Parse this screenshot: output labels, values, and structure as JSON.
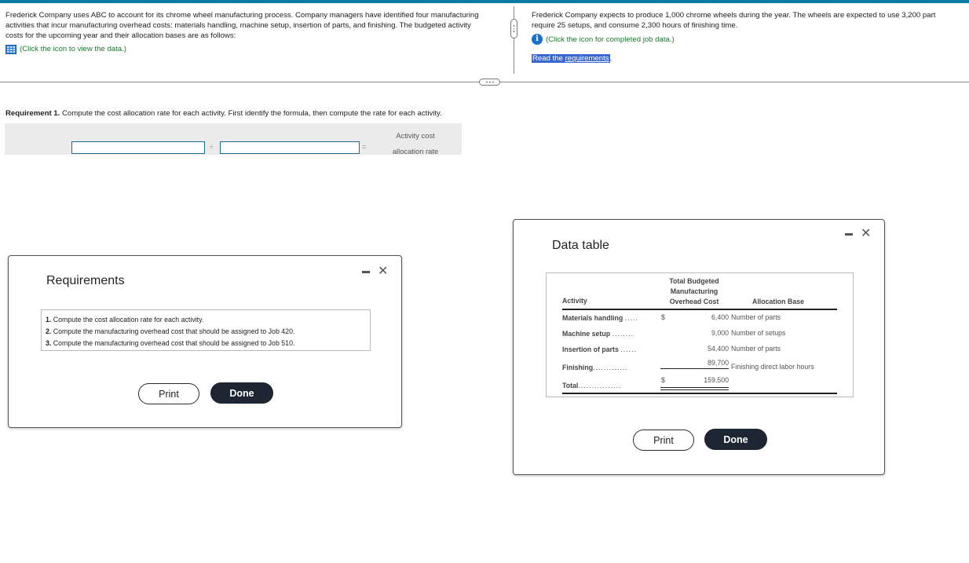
{
  "intro_left": {
    "text": "Frederick Company uses ABC to account for its chrome wheel manufacturing process. Company managers have identified four manufacturing activities that incur manufacturing overhead costs: materials handling, machine setup, insertion of parts, and finishing. The budgeted activity costs for the upcoming year and their allocation bases are as follows:",
    "data_link": "(Click the icon to view the data.)",
    "icon": "grid-icon"
  },
  "intro_right": {
    "line1": "Frederick Company expects to produce 1,000 chrome wheels during the year. The wheels are expected to use 3,200 part",
    "line2": "require 25 setups, and consume 2,300 hours of finishing time.",
    "job_link": "(Click the icon for completed job data.)",
    "icon": "info-icon",
    "read_prefix": "Read the ",
    "read_link": "requirements",
    "read_suffix": "."
  },
  "requirement1": {
    "label": "Requirement 1.",
    "text": " Compute the cost allocation rate for each activity. First identify the formula, then compute the rate for each activity.",
    "formula": {
      "input1_value": "",
      "operator_divide": "÷",
      "input2_value": "",
      "operator_equals": "=",
      "result_line1": "Activity cost",
      "result_line2": "allocation rate"
    }
  },
  "requirements_modal": {
    "title": "Requirements",
    "items": [
      {
        "num": "1.",
        "text": "Compute the cost allocation rate for each activity."
      },
      {
        "num": "2.",
        "text": "Compute the manufacturing overhead cost that should be assigned to Job 420."
      },
      {
        "num": "3.",
        "text": "Compute the manufacturing overhead cost that should be assigned to Job 510."
      }
    ],
    "print_label": "Print",
    "done_label": "Done",
    "minimize_icon": "minimize-icon",
    "close_icon": "close-icon"
  },
  "data_modal": {
    "title": "Data table",
    "headers": {
      "activity": "Activity",
      "cost_line1": "Total Budgeted",
      "cost_line2": "Manufacturing",
      "cost_line3": "Overhead Cost",
      "base": "Allocation Base"
    },
    "rows": [
      {
        "activity": "Materials handling",
        "dots": ".....",
        "currency": "$",
        "amount": "6,400",
        "base": "Number of parts"
      },
      {
        "activity": "Machine setup",
        "dots": "........",
        "currency": "",
        "amount": "9,000",
        "base": "Number of setups"
      },
      {
        "activity": "Insertion of parts",
        "dots": "......",
        "currency": "",
        "amount": "54,400",
        "base": "Number of parts"
      },
      {
        "activity": "Finishing",
        "dots": ".............",
        "currency": "",
        "amount": "89,700",
        "base": "Finishing direct labor hours"
      }
    ],
    "total": {
      "activity": "Total",
      "dots": "................",
      "currency": "$",
      "amount": "159,500"
    },
    "print_label": "Print",
    "done_label": "Done"
  }
}
